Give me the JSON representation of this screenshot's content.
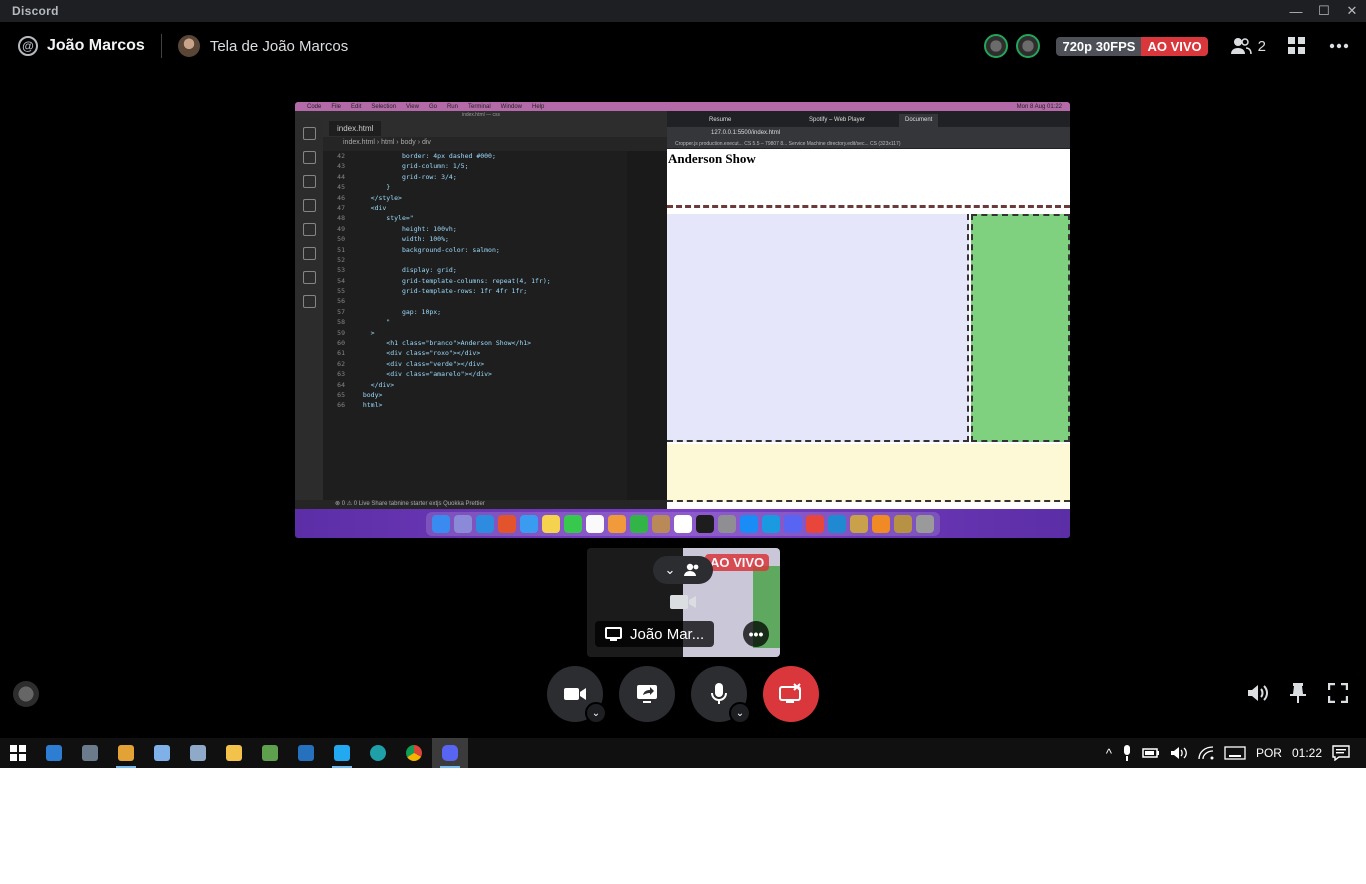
{
  "window": {
    "app_title": "Discord",
    "minimize": "—",
    "maximize": "☐",
    "close": "✕"
  },
  "header": {
    "at_symbol": "@",
    "user_name": "João Marcos",
    "screen_title": "Tela de João Marcos",
    "quality_badge": "720p 30FPS",
    "live_badge": "AO VIVO",
    "participant_count": "2"
  },
  "stream": {
    "mac_menu": [
      "Code",
      "File",
      "Edit",
      "Selection",
      "View",
      "Go",
      "Run",
      "Terminal",
      "Window",
      "Help"
    ],
    "mac_clock": "Mon 8 Aug 01:22",
    "vscode": {
      "window_title": "index.html — css",
      "tab_label": "index.html",
      "breadcrumb": "index.html › html › body › div",
      "status_bar": "⊗ 0 ⚠ 0   Live Share   tabnine starter   extjs   Quokka   Prettier",
      "code_lines": [
        {
          "n": "42",
          "t": "            border: 4px dashed #000;"
        },
        {
          "n": "43",
          "t": "            grid-column: 1/5;"
        },
        {
          "n": "44",
          "t": "            grid-row: 3/4;"
        },
        {
          "n": "45",
          "t": "        }"
        },
        {
          "n": "46",
          "t": "    </style>"
        },
        {
          "n": "47",
          "t": "    <div"
        },
        {
          "n": "48",
          "t": "        style=\""
        },
        {
          "n": "49",
          "t": "            height: 100vh;"
        },
        {
          "n": "50",
          "t": "            width: 100%;"
        },
        {
          "n": "51",
          "t": "            background-color: salmon;"
        },
        {
          "n": "52",
          "t": ""
        },
        {
          "n": "53",
          "t": "            display: grid;"
        },
        {
          "n": "54",
          "t": "            grid-template-columns: repeat(4, 1fr);"
        },
        {
          "n": "55",
          "t": "            grid-template-rows: 1fr 4fr 1fr;"
        },
        {
          "n": "56",
          "t": ""
        },
        {
          "n": "57",
          "t": "            gap: 10px;"
        },
        {
          "n": "58",
          "t": "        \""
        },
        {
          "n": "59",
          "t": "    >"
        },
        {
          "n": "60",
          "t": "        <h1 class=\"branco\">Anderson Show</h1>"
        },
        {
          "n": "61",
          "t": "        <div class=\"roxo\"></div>"
        },
        {
          "n": "62",
          "t": "        <div class=\"verde\"></div>"
        },
        {
          "n": "63",
          "t": "        <div class=\"amarelo\"></div>"
        },
        {
          "n": "64",
          "t": "    </div>"
        },
        {
          "n": "65",
          "t": "  body>"
        },
        {
          "n": "66",
          "t": "  html>"
        }
      ]
    },
    "browser": {
      "tabs": [
        "Resume",
        "Spotify – Web Player",
        "Document"
      ],
      "url": "127.0.0.1:5500/index.html",
      "bookmarks": "Cropper.js   production.execut...   CS 5.5 – 79807 8...   Service Machine   directory.edit/sec...   CS (323x117)",
      "page_heading": "Anderson Show"
    }
  },
  "thumbnail": {
    "live_badge": "AO VIVO",
    "name": "João Mar...",
    "more": "•••"
  },
  "taskbar": {
    "language": "POR",
    "time": "01:22"
  },
  "colors": {
    "live_red": "#da373c",
    "connected_green": "#23a55a",
    "control_bg": "#2b2d31"
  }
}
